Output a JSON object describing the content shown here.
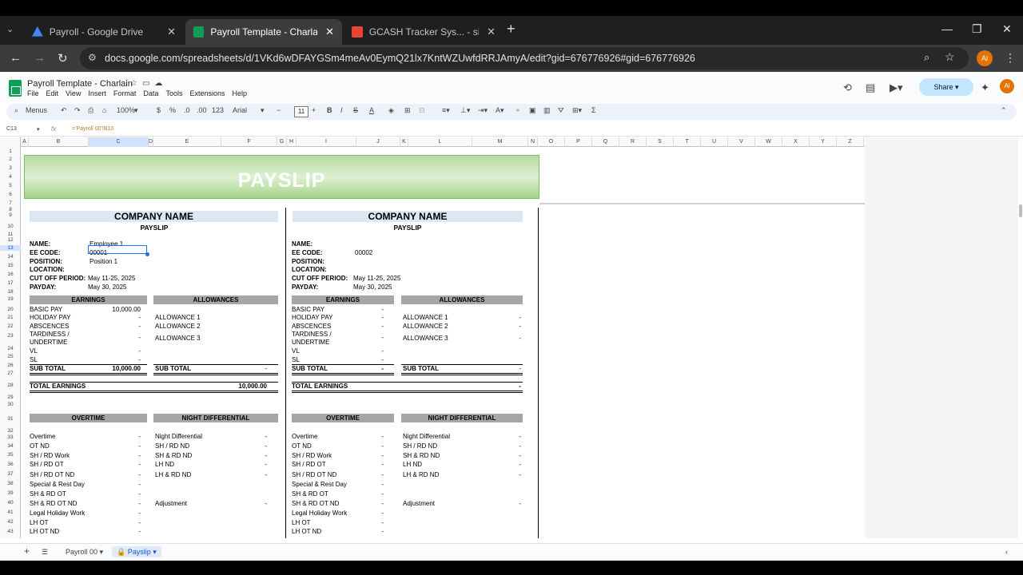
{
  "browser": {
    "tabs": [
      {
        "label": "Payroll - Google Drive",
        "color": "#4285f4"
      },
      {
        "label": "Payroll Template - Charlain - Go",
        "color": "#0f9d58"
      },
      {
        "label": "GCASH Tracker Sys... - sir arnel",
        "color": "#ea4335"
      }
    ],
    "url": "docs.google.com/spreadsheets/d/1VKd6wDFAYGSm4meAv0EymQ21lx7KntWZUwfdRRJAmyA/edit?gid=676776926#gid=676776926",
    "profile_initials": "Ai"
  },
  "doc": {
    "title": "Payroll Template - Charlain",
    "menus": [
      "File",
      "Edit",
      "View",
      "Insert",
      "Format",
      "Data",
      "Tools",
      "Extensions",
      "Help"
    ],
    "share_label": "Share",
    "avatar_initials": "Ai"
  },
  "toolbar": {
    "menus_label": "Menus",
    "zoom": "100%",
    "currency": "$",
    "percent": "%",
    "dec_less": ".0",
    "dec_more": ".00",
    "format_123": "123",
    "font": "Arial",
    "font_size": "11",
    "sigma": "Σ"
  },
  "formula_bar": {
    "name_box": "C13",
    "fx": "fx",
    "formula": "='Payroll 00'!B10"
  },
  "columns": [
    "A",
    "B",
    "C",
    "D",
    "E",
    "F",
    "G",
    "H",
    "I",
    "J",
    "K",
    "L",
    "M",
    "N",
    "O",
    "P",
    "Q",
    "R",
    "S",
    "T",
    "U",
    "V",
    "W",
    "X",
    "Y",
    "Z"
  ],
  "rows": [
    "1",
    "2",
    "3",
    "4",
    "5",
    "6",
    "7",
    "8",
    "9",
    "10",
    "11",
    "12",
    "13",
    "14",
    "15",
    "16",
    "17",
    "18",
    "19",
    "20",
    "21",
    "22",
    "23",
    "24",
    "25",
    "26",
    "27",
    "28",
    "29",
    "30",
    "31",
    "32",
    "33",
    "34",
    "35",
    "36",
    "37",
    "38",
    "39",
    "40",
    "41",
    "42",
    "43"
  ],
  "banner_title": "PAYSLIP",
  "slips": [
    {
      "company": "COMPANY NAME",
      "subtitle": "PAYSLIP",
      "name_label": "NAME:",
      "name": "Employee 1",
      "code_label": "EE CODE:",
      "code": "00001",
      "position_label": "POSITION:",
      "position": "Position 1",
      "location_label": "LOCATION:",
      "cutoff_label": "CUT OFF PERIOD:",
      "cutoff": "May 11-25, 2025",
      "payday_label": "PAYDAY:",
      "payday": "May 30, 2025",
      "earnings_hdr": "EARNINGS",
      "allowances_hdr": "ALLOWANCES",
      "earnings": [
        {
          "label": "BASIC PAY",
          "value": "10,000.00"
        },
        {
          "label": "HOLIDAY PAY",
          "value": "-"
        },
        {
          "label": "ABSCENCES",
          "value": "-"
        },
        {
          "label": "TARDINESS /",
          "label2": "UNDERTIME",
          "value": "-"
        },
        {
          "label": "VL",
          "value": "-"
        },
        {
          "label": "SL",
          "value": "-"
        }
      ],
      "allowances": [
        {
          "label": "ALLOWANCE 1",
          "value": ""
        },
        {
          "label": "ALLOWANCE 2",
          "value": ""
        },
        {
          "label": "ALLOWANCE 3",
          "value": ""
        }
      ],
      "sub_total_label": "SUB TOTAL",
      "earn_subtotal": "10,000.00",
      "allow_subtotal": "-",
      "total_label": "TOTAL EARNINGS",
      "total": "10,000.00",
      "overtime_hdr": "OVERTIME",
      "nd_hdr": "NIGHT DIFFERENTIAL",
      "overtime": [
        {
          "label": "Overtime",
          "value": "-"
        },
        {
          "label": "OT ND",
          "value": "-"
        },
        {
          "label": "SH / RD Work",
          "value": "-"
        },
        {
          "label": "SH / RD OT",
          "value": "-"
        },
        {
          "label": "SH / RD OT ND",
          "value": "-"
        },
        {
          "label": "Special & Rest Day",
          "value": "-"
        },
        {
          "label": "SH & RD OT",
          "value": "-"
        },
        {
          "label": "SH & RD OT ND",
          "value": "-"
        },
        {
          "label": "Legal Holiday Work",
          "value": "-"
        },
        {
          "label": "LH OT",
          "value": "-"
        },
        {
          "label": "LH OT ND",
          "value": "-"
        }
      ],
      "nd": [
        {
          "label": "Night Differential",
          "value": "-"
        },
        {
          "label": "SH / RD ND",
          "value": "-"
        },
        {
          "label": "SH & RD ND",
          "value": "-"
        },
        {
          "label": "LH ND",
          "value": "-"
        },
        {
          "label": "LH & RD ND",
          "value": "-"
        },
        {
          "label": "Adjustment",
          "value": "-"
        }
      ]
    },
    {
      "company": "COMPANY NAME",
      "subtitle": "PAYSLIP",
      "name_label": "NAME:",
      "name": "",
      "code_label": "EE CODE:",
      "code": "00002",
      "position_label": "POSITION:",
      "position": "",
      "location_label": "LOCATION:",
      "cutoff_label": "CUT OFF PERIOD:",
      "cutoff": "May 11-25, 2025",
      "payday_label": "PAYDAY:",
      "payday": "May 30, 2025",
      "earnings_hdr": "EARNINGS",
      "allowances_hdr": "ALLOWANCES",
      "earnings": [
        {
          "label": "BASIC PAY",
          "value": "-"
        },
        {
          "label": "HOLIDAY PAY",
          "value": "-"
        },
        {
          "label": "ABSCENCES",
          "value": "-"
        },
        {
          "label": "TARDINESS /",
          "label2": "UNDERTIME",
          "value": "-"
        },
        {
          "label": "VL",
          "value": "-"
        },
        {
          "label": "SL",
          "value": "-"
        }
      ],
      "allowances": [
        {
          "label": "ALLOWANCE 1",
          "value": "-"
        },
        {
          "label": "ALLOWANCE 2",
          "value": "-"
        },
        {
          "label": "ALLOWANCE 3",
          "value": "-"
        }
      ],
      "sub_total_label": "SUB TOTAL",
      "earn_subtotal": "-",
      "allow_subtotal": "-",
      "total_label": "TOTAL EARNINGS",
      "total": "-",
      "overtime_hdr": "OVERTIME",
      "nd_hdr": "NIGHT DIFFERENTIAL",
      "overtime": [
        {
          "label": "Overtime",
          "value": "-"
        },
        {
          "label": "OT ND",
          "value": "-"
        },
        {
          "label": "SH / RD Work",
          "value": "-"
        },
        {
          "label": "SH / RD OT",
          "value": "-"
        },
        {
          "label": "SH / RD OT ND",
          "value": "-"
        },
        {
          "label": "Special & Rest Day",
          "value": "-"
        },
        {
          "label": "SH & RD OT",
          "value": "-"
        },
        {
          "label": "SH & RD OT ND",
          "value": "-"
        },
        {
          "label": "Legal Holiday Work",
          "value": "-"
        },
        {
          "label": "LH OT",
          "value": "-"
        },
        {
          "label": "LH OT ND",
          "value": "-"
        }
      ],
      "nd": [
        {
          "label": "Night Differential",
          "value": "-"
        },
        {
          "label": "SH / RD ND",
          "value": "-"
        },
        {
          "label": "SH & RD ND",
          "value": "-"
        },
        {
          "label": "LH ND",
          "value": "-"
        },
        {
          "label": "LH & RD ND",
          "value": "-"
        },
        {
          "label": "Adjustment",
          "value": "-"
        }
      ]
    }
  ],
  "sheet_tabs": [
    "Payroll 00",
    "Payslip"
  ]
}
